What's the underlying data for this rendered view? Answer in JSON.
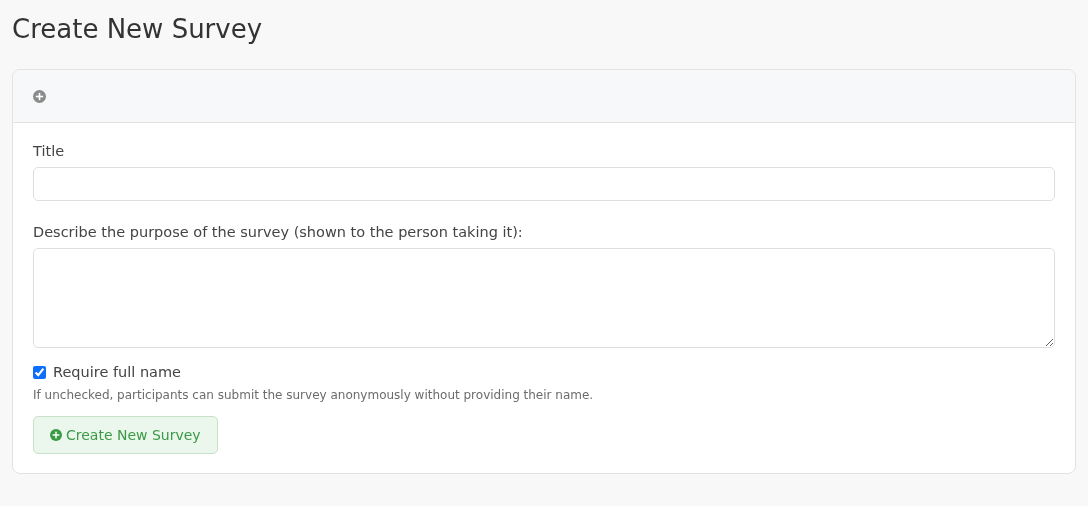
{
  "page_title": "Create New Survey",
  "form": {
    "title_field": {
      "label": "Title"
    },
    "description_field": {
      "label": "Describe the purpose of the survey (shown to the person taking it):"
    },
    "require_name": {
      "label": "Require full name",
      "checked": true
    },
    "help_text": "If unchecked, participants can submit the survey anonymously without providing their name.",
    "submit_button": {
      "label": "Create New Survey"
    }
  }
}
